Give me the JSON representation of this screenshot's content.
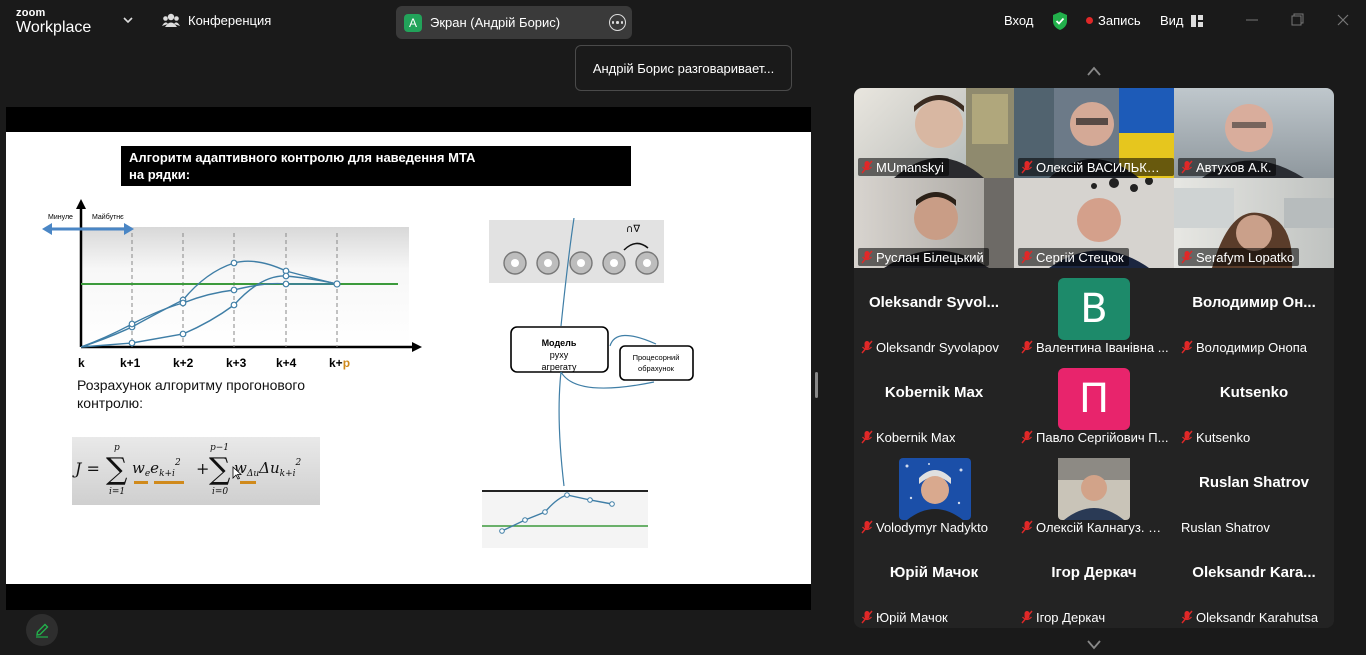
{
  "app": {
    "logo_top": "zoom",
    "logo_bottom": "Workplace"
  },
  "titlebar": {
    "meeting_label": "Конференция",
    "share_badge": "А",
    "share_label": "Экран (Андрій Борис)",
    "signin_label": "Вход",
    "record_label": "Запись",
    "view_label": "Вид"
  },
  "speaking_tooltip": "Андрій Борис разговаривает...",
  "slide": {
    "title_line1": "Алгоритм адаптивного  контролю для наведення МТА",
    "title_line2": "на рядки:",
    "past_label": "Минуле",
    "future_label": "Майбутнє",
    "axis_k": "k",
    "axis_k1": "k+1",
    "axis_k2": "k+2",
    "axis_k3": "k+3",
    "axis_k4": "k+4",
    "axis_kp_prefix": "k+",
    "axis_kp_suffix": "p",
    "text_line1": "Розрахунок алгоритму прогонового",
    "text_line2": "контролю:",
    "formula": "J = Σ wₑeₖ₊ᵢ² + Σ wΔuΔuₖ₊ᵢ²",
    "formula_sum1_top": "p",
    "formula_sum1_bottom": "i=1",
    "formula_sum2_top": "p−1",
    "formula_sum2_bottom": "i=0",
    "model_box_line1": "Модель",
    "model_box_line2": "руху",
    "model_box_line3": "агрегату",
    "processor_box_line1": "Процесорний",
    "processor_box_line2": "обрахунок",
    "machine_symbol": "∩∇"
  },
  "participants": [
    {
      "name": "MUmanskyi",
      "type": "video"
    },
    {
      "name": "Олексій ВАСИЛЬКОВ...",
      "type": "video"
    },
    {
      "name": "Автухов А.К.",
      "type": "video"
    },
    {
      "name": "Руслан Білецький",
      "type": "video"
    },
    {
      "name": "Сергій Стецюк",
      "type": "video"
    },
    {
      "name": "Serafym Lopatko",
      "type": "video"
    },
    {
      "name": "Oleksandr Syvolapov",
      "big": "Oleksandr  Syvol...",
      "type": "name"
    },
    {
      "name": "Валентина Іванівна ...",
      "avatar": "В",
      "type": "avatar"
    },
    {
      "name": "Володимир Онопа",
      "big": "Володимир  Он...",
      "type": "name"
    },
    {
      "name": "Kobernik Max",
      "big": "Kobernik Max",
      "type": "name"
    },
    {
      "name": "Павло Сергійович П...",
      "avatar": "П",
      "type": "avatar"
    },
    {
      "name": "Kutsenko",
      "big": "Kutsenko",
      "type": "name"
    },
    {
      "name": "Volodymyr Nadykto",
      "type": "photo"
    },
    {
      "name": "Олексій Калнагуз. Су...",
      "type": "photo"
    },
    {
      "name": "Ruslan Shatrov",
      "big": "Ruslan Shatrov",
      "type": "name"
    },
    {
      "name": "Юрій Мачок",
      "big": "Юрій Мачок",
      "type": "name"
    },
    {
      "name": "Ігор Деркач",
      "big": "Ігор Деркач",
      "type": "name"
    },
    {
      "name": "Oleksandr Karahutsa",
      "big": "Oleksandr  Kara...",
      "type": "name"
    }
  ],
  "colors": {
    "background": "#1a1a1a",
    "muted_mic": "#e02828",
    "shield": "#22b04b",
    "record_dot": "#e02828",
    "avatar_b": "#1d8a6a",
    "avatar_p": "#e8246c",
    "plot_curve": "#3f7ea6",
    "plot_target": "#3c9a3c"
  },
  "icons": [
    "chevron-down-icon",
    "participants-icon",
    "more-icon",
    "shield-icon",
    "record-icon",
    "grid-icon",
    "minimize-icon",
    "restore-icon",
    "close-icon",
    "muted-mic-icon",
    "scroll-up-icon",
    "scroll-down-icon",
    "annotate-icon"
  ]
}
